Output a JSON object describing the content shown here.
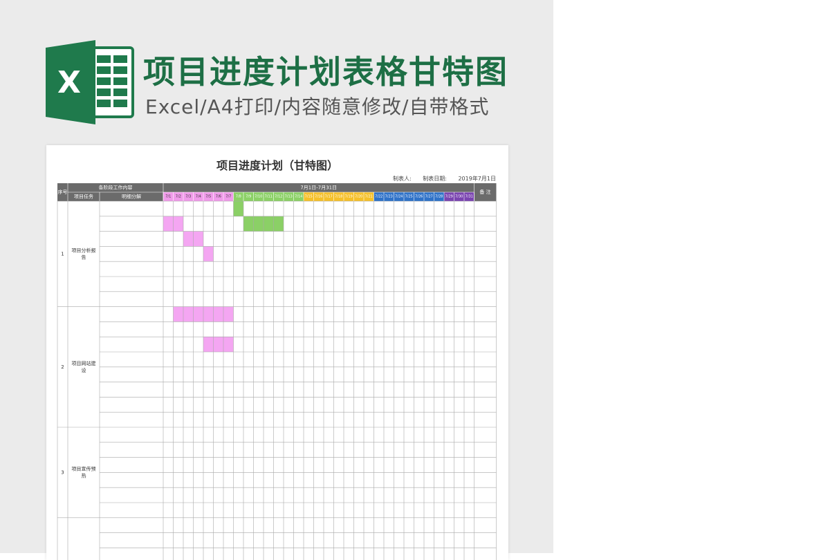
{
  "banner": {
    "title": "项目进度计划表格甘特图",
    "subtitle": "Excel/A4打印/内容随意修改/自带格式",
    "logo_letter": "X"
  },
  "doc": {
    "title": "项目进度计划（甘特图）",
    "maker_label": "制表人:",
    "date_label": "制表日期:",
    "date_value": "2019年7月1日"
  },
  "table": {
    "col_seq": "序号",
    "col_group": "各阶段工作内容",
    "col_task": "项目任务",
    "col_detail": "明细分解",
    "col_period": "7月1日-7月31日",
    "col_remark": "备 注",
    "days": [
      "7/1",
      "7/2",
      "7/3",
      "7/4",
      "7/5",
      "7/6",
      "7/7",
      "7/8",
      "7/9",
      "7/10",
      "7/11",
      "7/12",
      "7/13",
      "7/14",
      "7/15",
      "7/16",
      "7/17",
      "7/18",
      "7/19",
      "7/20",
      "7/21",
      "7/22",
      "7/23",
      "7/24",
      "7/25",
      "7/26",
      "7/27",
      "7/28",
      "7/29",
      "7/30",
      "7/31"
    ],
    "day_colors": [
      "#ef9ae9",
      "#ef9ae9",
      "#ef9ae9",
      "#ef9ae9",
      "#ef9ae9",
      "#ef9ae9",
      "#ef9ae9",
      "#8bd066",
      "#8bd066",
      "#8bd066",
      "#8bd066",
      "#8bd066",
      "#8bd066",
      "#8bd066",
      "#f5c02a",
      "#f5c02a",
      "#f5c02a",
      "#f5c02a",
      "#f5c02a",
      "#f5c02a",
      "#f5c02a",
      "#2f72c8",
      "#2f72c8",
      "#2f72c8",
      "#2f72c8",
      "#2f72c8",
      "#2f72c8",
      "#2f72c8",
      "#7a44b0",
      "#7a44b0",
      "#7a44b0"
    ],
    "groups": [
      {
        "seq": "1",
        "task": "项目分析报告",
        "rows": 7
      },
      {
        "seq": "2",
        "task": "项目网站建设",
        "rows": 8
      },
      {
        "seq": "3",
        "task": "项目宣传预热",
        "rows": 6
      },
      {
        "seq": "",
        "task": "",
        "rows": 3
      }
    ],
    "bars": [
      {
        "row": 0,
        "start": 7,
        "len": 1,
        "color": "#8bd066"
      },
      {
        "row": 1,
        "start": 0,
        "len": 2,
        "color": "#f4a6f2"
      },
      {
        "row": 1,
        "start": 8,
        "len": 4,
        "color": "#8bd066"
      },
      {
        "row": 2,
        "start": 2,
        "len": 2,
        "color": "#f4a6f2"
      },
      {
        "row": 3,
        "start": 4,
        "len": 1,
        "color": "#f4a6f2"
      },
      {
        "row": 7,
        "start": 1,
        "len": 6,
        "color": "#f4a6f2"
      },
      {
        "row": 9,
        "start": 4,
        "len": 3,
        "color": "#f4a6f2"
      }
    ]
  }
}
